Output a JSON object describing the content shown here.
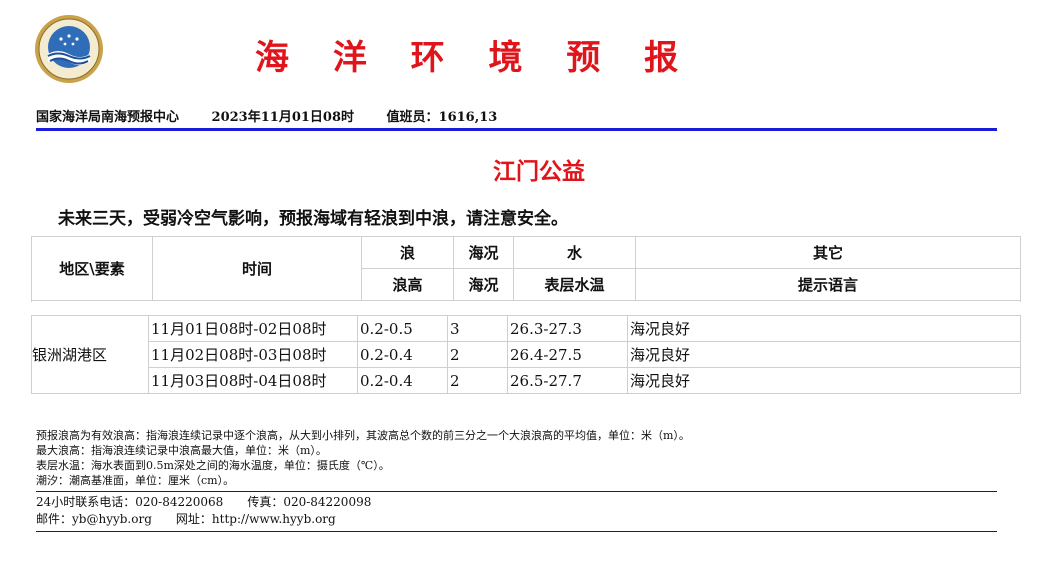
{
  "header": {
    "title": "海 洋 环 境 预 报",
    "title_color": "#e0151b",
    "org": "国家海洋局南海预报中心",
    "datetime": "2023年11月01日08时",
    "duty": "值班员：1616,13",
    "rule_color": "#1b1bd8"
  },
  "area": {
    "title": "江门公益",
    "summary": "未来三天，受弱冷空气影响，预报海域有轻浪到中浪，请注意安全。"
  },
  "table": {
    "head_row1": [
      "地区\\要素",
      "时间",
      "浪",
      "海况",
      "水",
      "其它"
    ],
    "head_row2": [
      "浪高",
      "海况",
      "表层水温",
      "提示语言"
    ],
    "region": "银洲湖港区",
    "rows": [
      {
        "time": "11月01日08时-02日08时",
        "wave": "0.2-0.5",
        "sea": "3",
        "temp": "26.3-27.3",
        "note": "海况良好"
      },
      {
        "time": "11月02日08时-03日08时",
        "wave": "0.2-0.4",
        "sea": "2",
        "temp": "26.4-27.5",
        "note": "海况良好"
      },
      {
        "time": "11月03日08时-04日08时",
        "wave": "0.2-0.4",
        "sea": "2",
        "temp": "26.5-27.7",
        "note": "海况良好"
      }
    ]
  },
  "notes": [
    "预报浪高为有效浪高：指海浪连续记录中逐个浪高，从大到小排列，其波高总个数的前三分之一个大浪浪高的平均值，单位：米（m）。",
    "最大浪高：指海浪连续记录中浪高最大值，单位：米（m）。",
    "表层水温：海水表面到0.5m深处之间的海水温度，单位：摄氏度（℃）。",
    "潮汐：潮高基准面，单位：厘米（cm）。"
  ],
  "contact": {
    "phone": "24小时联系电话：020-84220068",
    "fax": "传真：020-84220098",
    "email": "邮件：yb@hyyb.org",
    "site": "网址：http://www.hyyb.org"
  }
}
